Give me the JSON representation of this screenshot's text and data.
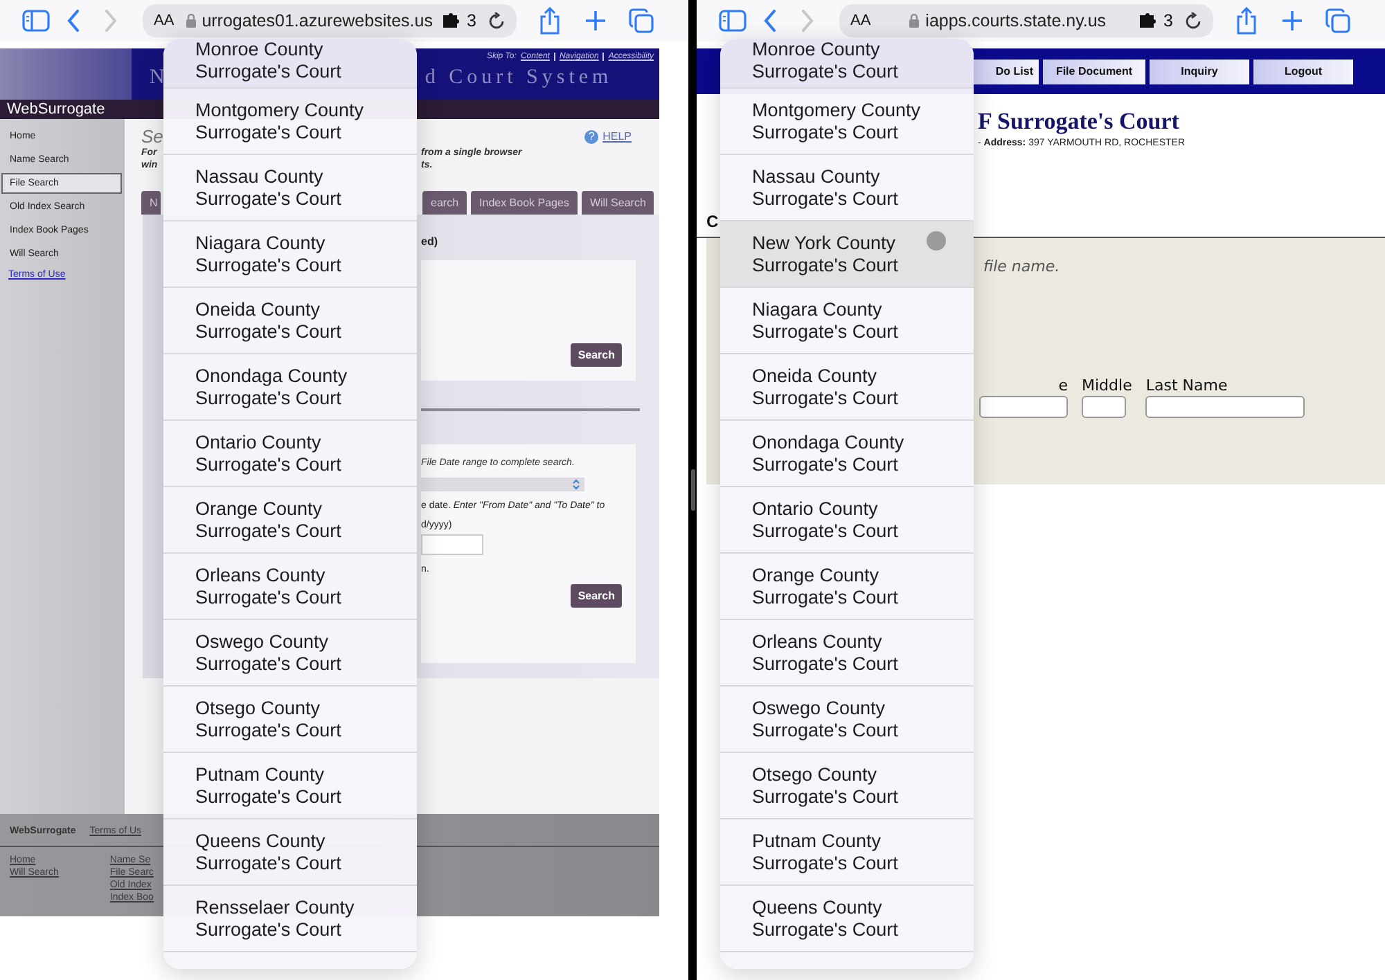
{
  "left_window": {
    "toolbar": {
      "text_size_label": "AA",
      "url": "urrogates01.azurewebsites.us",
      "extensions_count": "3"
    },
    "header": {
      "title_start": "N",
      "title_end": "d Court System",
      "skip_to_label": "Skip To:",
      "skip_links": [
        "Content",
        "Navigation",
        "Accessibility"
      ],
      "brand": "WebSurrogate"
    },
    "sidebar": {
      "items": [
        {
          "label": "Home",
          "selected": false
        },
        {
          "label": "Name Search",
          "selected": false
        },
        {
          "label": "File Search",
          "selected": true
        },
        {
          "label": "Old Index Search",
          "selected": false
        },
        {
          "label": "Index Book Pages",
          "selected": false
        },
        {
          "label": "Will Search",
          "selected": false
        }
      ],
      "terms_link": "Terms of Use"
    },
    "main": {
      "heading": "Se",
      "help_icon": "?",
      "help_link": "HELP",
      "intro_lines": [
        {
          "left": "For",
          "right": "from a single browser"
        },
        {
          "left": "win",
          "right": "ts."
        }
      ],
      "tabs": [
        "N",
        "earch",
        "Index Book Pages",
        "Will Search"
      ],
      "section_1": {
        "label": "ed)",
        "button": "Search"
      },
      "section_2": {
        "instruction": "File Date range to complete search.",
        "date_note": "e date. *Enter \"From Date\" and \"To Date\" to*",
        "format_hint": "d/yyyy)",
        "note": "n.",
        "button": "Search"
      }
    },
    "footer": {
      "brand": "WebSurrogate",
      "terms_link": "Terms of Us",
      "links_col_1": [
        "Home",
        "Will Search"
      ],
      "links_col_2": [
        "Name Se",
        "File Searc",
        "Old Index",
        "Index Boo"
      ]
    },
    "dropdown": {
      "options": [
        {
          "label": "Monroe County Surrogate's Court",
          "selected": false
        },
        {
          "label": "Montgomery County Surrogate's Court",
          "selected": false
        },
        {
          "label": "Nassau County Surrogate's Court",
          "selected": false
        },
        {
          "label": "Niagara County Surrogate's Court",
          "selected": false
        },
        {
          "label": "Oneida County Surrogate's Court",
          "selected": false
        },
        {
          "label": "Onondaga County Surrogate's Court",
          "selected": false
        },
        {
          "label": "Ontario County Surrogate's Court",
          "selected": false
        },
        {
          "label": "Orange County Surrogate's Court",
          "selected": false
        },
        {
          "label": "Orleans County Surrogate's Court",
          "selected": false
        },
        {
          "label": "Oswego County Surrogate's Court",
          "selected": false
        },
        {
          "label": "Otsego County Surrogate's Court",
          "selected": false
        },
        {
          "label": "Putnam County Surrogate's Court",
          "selected": false
        },
        {
          "label": "Queens County Surrogate's Court",
          "selected": false
        },
        {
          "label": "Rensselaer County Surrogate's Court",
          "selected": false
        }
      ]
    }
  },
  "right_window": {
    "toolbar": {
      "text_size_label": "AA",
      "url": "iapps.courts.state.ny.us",
      "extensions_count": "3"
    },
    "nav_buttons": [
      "Do List",
      "File Document",
      "Inquiry",
      "Logout"
    ],
    "court_title": "F Surrogate's Court",
    "address": "- **Address:** 397 YARMOUTH RD, ROCHESTER",
    "section_heading": "C",
    "instruction": "file name.",
    "name_fields": [
      {
        "label": "e"
      },
      {
        "label": "Middle"
      },
      {
        "label": "Last Name"
      }
    ],
    "dropdown": {
      "options": [
        {
          "label": "Monroe County Surrogate's Court",
          "selected": false
        },
        {
          "label": "Montgomery County Surrogate's Court",
          "selected": false
        },
        {
          "label": "Nassau County Surrogate's Court",
          "selected": false
        },
        {
          "label": "New York County Surrogate's Court",
          "selected": true
        },
        {
          "label": "Niagara County Surrogate's Court",
          "selected": false
        },
        {
          "label": "Oneida County Surrogate's Court",
          "selected": false
        },
        {
          "label": "Onondaga County Surrogate's Court",
          "selected": false
        },
        {
          "label": "Ontario County Surrogate's Court",
          "selected": false
        },
        {
          "label": "Orange County Surrogate's Court",
          "selected": false
        },
        {
          "label": "Orleans County Surrogate's Court",
          "selected": false
        },
        {
          "label": "Oswego County Surrogate's Court",
          "selected": false
        },
        {
          "label": "Otsego County Surrogate's Court",
          "selected": false
        },
        {
          "label": "Putnam County Surrogate's Court",
          "selected": false
        },
        {
          "label": "Queens County Surrogate's Court",
          "selected": false
        }
      ]
    }
  }
}
